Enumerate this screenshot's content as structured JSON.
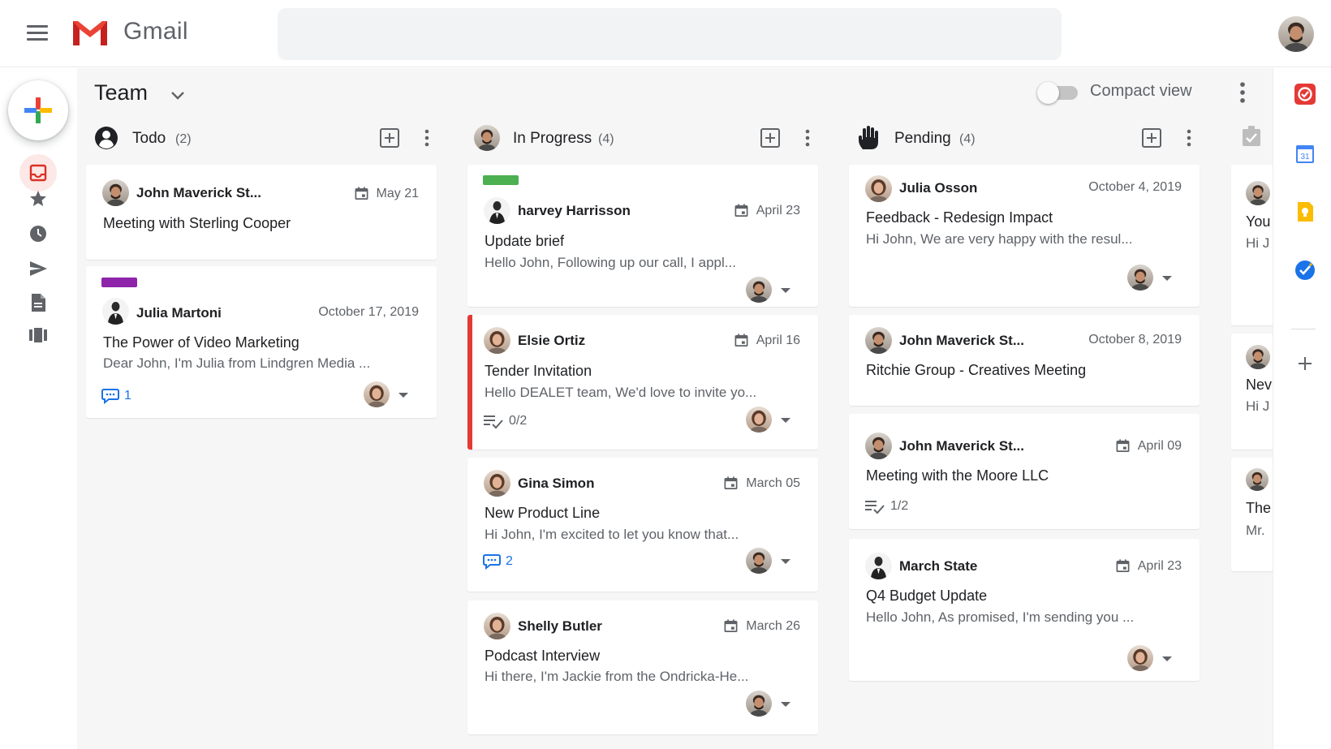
{
  "app": {
    "name": "Gmail",
    "search_placeholder": ""
  },
  "icons": {
    "menu": "hamburger-icon",
    "compose": "plus-icon",
    "inbox": "inbox-icon",
    "starred": "star-icon",
    "snoozed": "clock-icon",
    "sent": "send-icon",
    "drafts": "document-icon",
    "boards": "board-icon"
  },
  "colors": {
    "gmail_red": "#ea4335",
    "label_green": "#4caf50",
    "label_purple": "#8e24aa",
    "accent_red": "#e53935",
    "link_blue": "#1a73e8"
  },
  "board": {
    "title": "Team",
    "compact_label": "Compact view",
    "compact_on": false
  },
  "columns": [
    {
      "title": "Todo",
      "count": "(2)",
      "icon": "person-circle-icon",
      "cards": [
        {
          "sender": "John Maverick St...",
          "date": "May 21",
          "subject": "Meeting with Sterling Cooper",
          "snippet": ""
        },
        {
          "sender": "Julia Martoni",
          "date": "October 17, 2019",
          "subject": "The Power of Video Marketing",
          "snippet": "Dear John, I'm Julia from Lindgren Media ...",
          "comments": "1"
        }
      ]
    },
    {
      "title": "In Progress",
      "count": "(4)",
      "icon": "avatar",
      "cards": [
        {
          "sender": "harvey Harrisson",
          "date": "April 23",
          "subject": "Update brief",
          "snippet": "Hello John, Following up our call, I appl..."
        },
        {
          "sender": "Elsie Ortiz",
          "date": "April 16",
          "subject": "Tender Invitation",
          "snippet": "Hello DEALET team, We'd love to invite yo...",
          "tasks": "0/2"
        },
        {
          "sender": "Gina Simon",
          "date": "March 05",
          "subject": "New Product Line",
          "snippet": "Hi John, I'm excited to let you know that...",
          "comments": "2"
        },
        {
          "sender": "Shelly Butler",
          "date": "March 26",
          "subject": "Podcast Interview",
          "snippet": "Hi there, I'm Jackie from the Ondricka-He..."
        }
      ]
    },
    {
      "title": "Pending",
      "count": "(4)",
      "icon": "hand-icon",
      "cards": [
        {
          "sender": "Julia Osson",
          "date": "October 4, 2019",
          "subject": "Feedback - Redesign Impact",
          "snippet": "Hi John, We are very happy with the resul..."
        },
        {
          "sender": "John Maverick St...",
          "date": "October 8, 2019",
          "subject": "Ritchie Group - Creatives Meeting",
          "snippet": ""
        },
        {
          "sender": "John Maverick St...",
          "date": "April 09",
          "subject": "Meeting with the Moore LLC",
          "snippet": "",
          "tasks": "1/2"
        },
        {
          "sender": "March State",
          "date": "April 23",
          "subject": "Q4 Budget Update",
          "snippet": "Hello John, As promised, I'm sending you ..."
        }
      ]
    },
    {
      "title": "",
      "count": "",
      "icon": "checkbox-icon",
      "cards": [
        {
          "subject": "You",
          "snippet": "Hi J"
        },
        {
          "subject": "Nev",
          "snippet": "Hi J"
        },
        {
          "subject": "The",
          "snippet": "Mr."
        }
      ]
    }
  ],
  "side_apps": [
    "dealet-icon",
    "calendar-icon",
    "keep-icon",
    "tasks-icon",
    "add-icon"
  ],
  "calendar_day": "31"
}
